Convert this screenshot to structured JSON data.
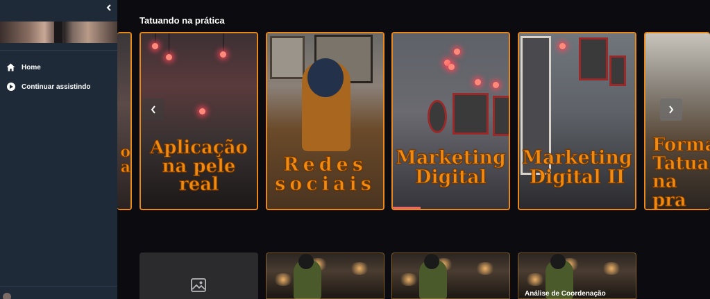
{
  "sidebar": {
    "collapse_icon": "chevron-left-icon",
    "nav": [
      {
        "label": "Home",
        "icon": "home-icon"
      },
      {
        "label": "Continuar assistindo",
        "icon": "play-circle-icon"
      }
    ]
  },
  "section": {
    "title": "Tatuando na prática",
    "cards": [
      {
        "title": "o\na"
      },
      {
        "title": "Aplicação\nna pele\nreal"
      },
      {
        "title": "Redes\nsociais"
      },
      {
        "title": "Marketing\nDigital",
        "progress": 0.24
      },
      {
        "title": "Marketing\nDigital  II"
      },
      {
        "title": "Forma\nTatua\nna pra"
      }
    ],
    "prev_icon": "chevron-left-icon",
    "next_icon": "chevron-right-icon"
  },
  "row2": {
    "thumbs": [
      {
        "type": "placeholder",
        "icon": "image-icon",
        "caption": ""
      },
      {
        "type": "photo",
        "caption": ""
      },
      {
        "type": "photo",
        "caption": ""
      },
      {
        "type": "photo",
        "caption": "Análise de Coordenação"
      }
    ]
  },
  "colors": {
    "accent": "#e8891a",
    "sidebar_bg": "#1e2a38",
    "page_bg": "#0c0c10"
  }
}
